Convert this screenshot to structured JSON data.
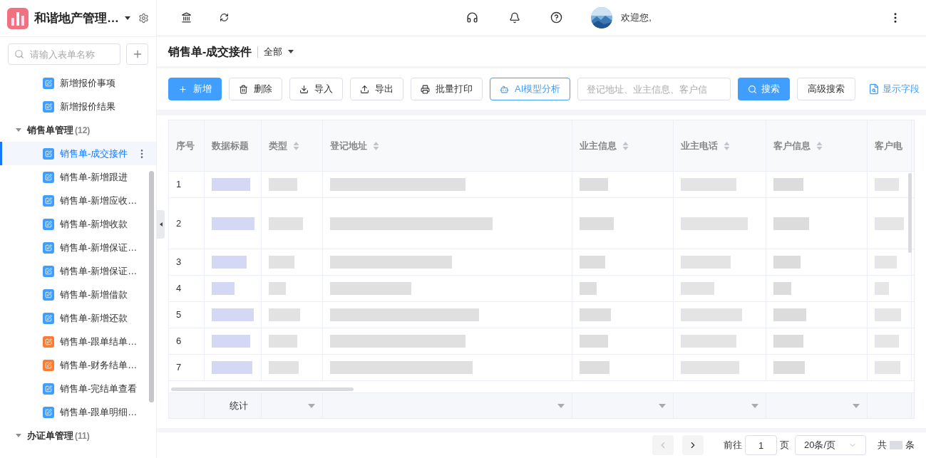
{
  "app": {
    "title": "和谐地产管理…"
  },
  "sidebar": {
    "search_placeholder": "请输入表单名称",
    "tree": [
      {
        "kind": "leaf",
        "label": "新增报价事项",
        "color": "#409eff",
        "selected": false
      },
      {
        "kind": "leaf",
        "label": "新增报价结果",
        "color": "#409eff",
        "selected": false
      },
      {
        "kind": "group",
        "label": "销售单管理",
        "count": "(12)",
        "expanded": true,
        "children": [
          {
            "kind": "leaf",
            "label": "销售单-成交接件",
            "color": "#409eff",
            "selected": true
          },
          {
            "kind": "leaf",
            "label": "销售单-新增跟进",
            "color": "#409eff",
            "selected": false
          },
          {
            "kind": "leaf",
            "label": "销售单-新增应收…",
            "color": "#409eff",
            "selected": false
          },
          {
            "kind": "leaf",
            "label": "销售单-新增收款",
            "color": "#409eff",
            "selected": false
          },
          {
            "kind": "leaf",
            "label": "销售单-新增保证…",
            "color": "#409eff",
            "selected": false
          },
          {
            "kind": "leaf",
            "label": "销售单-新增保证…",
            "color": "#409eff",
            "selected": false
          },
          {
            "kind": "leaf",
            "label": "销售单-新增借款",
            "color": "#409eff",
            "selected": false
          },
          {
            "kind": "leaf",
            "label": "销售单-新增还款",
            "color": "#409eff",
            "selected": false
          },
          {
            "kind": "leaf",
            "label": "销售单-跟单结单…",
            "color": "#fb7d33",
            "selected": false
          },
          {
            "kind": "leaf",
            "label": "销售单-财务结单…",
            "color": "#fb7d33",
            "selected": false
          },
          {
            "kind": "leaf",
            "label": "销售单-完结单查看",
            "color": "#409eff",
            "selected": false
          },
          {
            "kind": "leaf",
            "label": "销售单-跟单明细…",
            "color": "#409eff",
            "selected": false
          }
        ]
      },
      {
        "kind": "group",
        "label": "办证单管理",
        "count": "(11)",
        "expanded": true
      }
    ]
  },
  "header": {
    "welcome": "欢迎您,"
  },
  "page": {
    "title": "销售单-成交接件",
    "filter": "全部"
  },
  "toolbar": {
    "buttons": [
      {
        "kind": "primary",
        "label": "新增"
      },
      {
        "kind": "default",
        "label": "删除"
      },
      {
        "kind": "default",
        "label": "导入"
      },
      {
        "kind": "default",
        "label": "导出"
      },
      {
        "kind": "default",
        "label": "批量打印"
      },
      {
        "kind": "outline",
        "label": "AI模型分析"
      }
    ],
    "search": {
      "placeholder": "登记地址、业主信息、客户信"
    },
    "search_button": "搜索",
    "advanced_button": "高级搜索",
    "fields_link": "显示字段"
  },
  "table": {
    "columns": [
      {
        "label": "序号",
        "sortable": false
      },
      {
        "label": "数据标题",
        "sortable": false
      },
      {
        "label": "类型",
        "sortable": true
      },
      {
        "label": "登记地址",
        "sortable": true
      },
      {
        "label": "业主信息",
        "sortable": true
      },
      {
        "label": "业主电话",
        "sortable": true
      },
      {
        "label": "客户信息",
        "sortable": true
      },
      {
        "label": "客户电",
        "sortable": false
      }
    ],
    "rows": [
      {
        "index": "1"
      },
      {
        "index": "2"
      },
      {
        "index": "3"
      },
      {
        "index": "4"
      },
      {
        "index": "5"
      },
      {
        "index": "6"
      },
      {
        "index": "7"
      }
    ],
    "footer_label": "统计"
  },
  "pagination": {
    "prev_disabled": true,
    "next_disabled": false,
    "goto_label": "前往",
    "page": "1",
    "page_unit": "页",
    "page_size": "20条/页",
    "total_prefix": "共",
    "total_suffix": "条"
  }
}
